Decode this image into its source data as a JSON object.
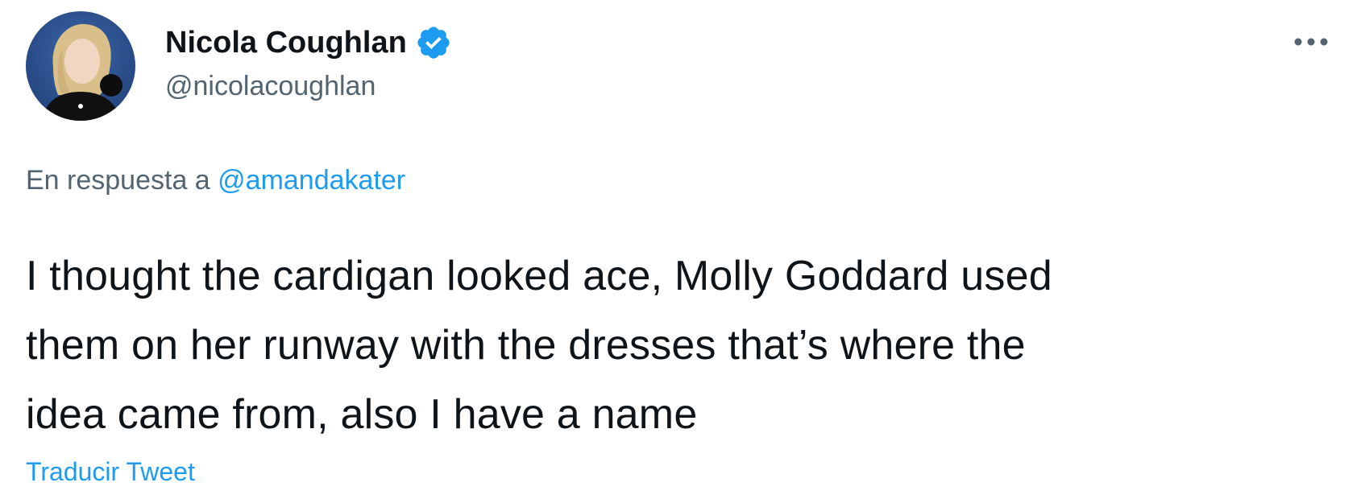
{
  "author": {
    "display_name": "Nicola Coughlan",
    "handle": "@nicolacoughlan",
    "verified": true,
    "avatar_icon": "profile-photo"
  },
  "menu": {
    "icon": "more-horizontal-icon"
  },
  "reply": {
    "prefix": "En respuesta a",
    "mention": "@amandakater"
  },
  "tweet": {
    "lines": [
      "I thought the cardigan looked ace, Molly Goddard used",
      "them on her runway with the dresses that’s where the",
      "idea came from, also I have a name"
    ]
  },
  "translate_label": "Traducir Tweet",
  "colors": {
    "accent": "#1d9bf0",
    "text": "#0f1419",
    "secondary": "#536471"
  }
}
